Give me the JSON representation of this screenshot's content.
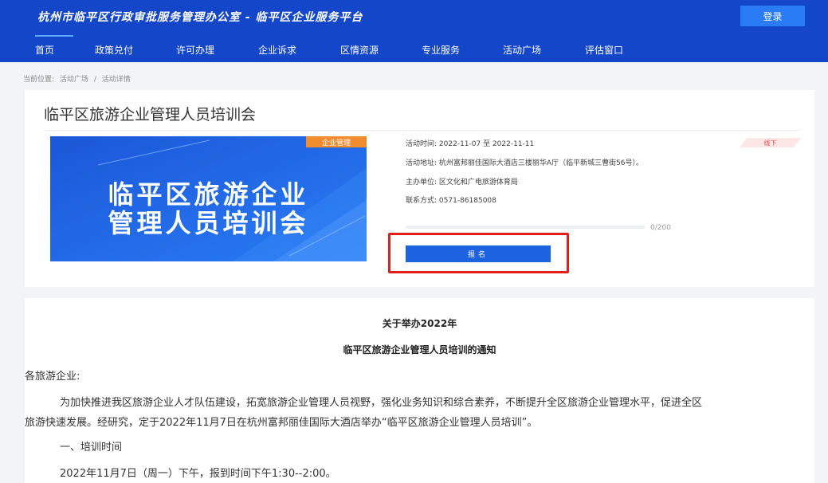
{
  "header": {
    "site_title": "杭州市临平区行政审批服务管理办公室 - 临平区企业服务平台",
    "login_label": "登录"
  },
  "nav": {
    "items": [
      "首页",
      "政策兑付",
      "许可办理",
      "企业诉求",
      "区情资源",
      "专业服务",
      "活动广场",
      "评估窗口"
    ]
  },
  "breadcrumb": {
    "prefix": "当前位置:",
    "level1": "活动广场",
    "separator": "/",
    "level2": "活动详情"
  },
  "activity": {
    "title": "临平区旅游企业管理人员培训会",
    "banner_tag": "企业管理",
    "banner_line1": "临平区旅游企业",
    "banner_line2": "管理人员培训会",
    "mode_badge": "线下",
    "time_label": "活动时间:",
    "time_value": "2022-11-07 至 2022-11-11",
    "address_label": "活动地址:",
    "address_value": "杭州富邦丽佳国际大酒店三楼丽华A厅（临平新城三曹街56号）。",
    "organizer_label": "主办单位:",
    "organizer_value": "区文化和广电旅游体育局",
    "contact_label": "联系方式:",
    "contact_value": "0571-86185008",
    "enrolled_fraction": 0,
    "progress_text": "0/200",
    "signup_label": "报名"
  },
  "article": {
    "title_line1": "关于举办2022年",
    "title_line2": "临平区旅游企业管理人员培训的通知",
    "greeting": "各旅游企业:",
    "para1_line1": "为加快推进我区旅游企业人才队伍建设，拓宽旅游企业管理人员视野，强化业务知识和综合素养，不断提升全区旅游企业管理水平，促进全区",
    "para1_line2": "旅游快速发展。经研究，定于2022年11月7日在杭州富邦丽佳国际大酒店举办“临平区旅游企业管理人员培训”。",
    "section1_heading": "一、培训时间",
    "section1_text": "2022年11月7日（周一）下午，报到时间下午1:30--2:00。"
  },
  "colors": {
    "header_bg": "#1346c9",
    "accent": "#1d62e0",
    "highlight": "#e31c1c",
    "tag_orange": "#f08b2e"
  }
}
